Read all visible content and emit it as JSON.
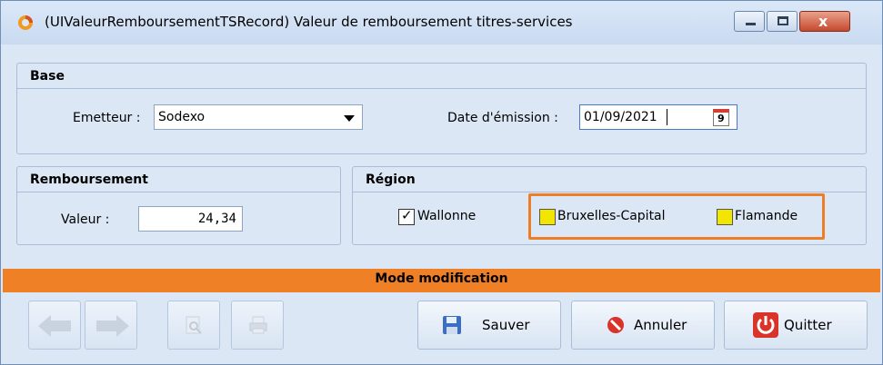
{
  "window": {
    "title": "(UIValeurRemboursementTSRecord) Valeur de remboursement titres-services",
    "close_glyph": "x"
  },
  "base": {
    "heading": "Base",
    "emetteur_label": "Emetteur :",
    "emetteur_value": "Sodexo",
    "date_label": "Date d'émission :",
    "date_value": "01/09/2021",
    "calendar_day": "9"
  },
  "remboursement": {
    "heading": "Remboursement",
    "valeur_label": "Valeur :",
    "valeur_value": "24,34"
  },
  "region": {
    "heading": "Région",
    "options": [
      {
        "label": "Wallonne",
        "checked": true
      },
      {
        "label": "Bruxelles-Capital",
        "checked": false
      },
      {
        "label": "Flamande",
        "checked": false
      }
    ],
    "check_mark": "✓"
  },
  "status": {
    "mode": "Mode modification"
  },
  "toolbar": {
    "save_label": "Sauver",
    "cancel_label": "Annuler",
    "quit_label": "Quitter"
  },
  "colors": {
    "accent_orange": "#ef8026",
    "highlight_border": "#ee7d28",
    "checkbox_yellow": "#f2e600",
    "panel_bg": "#dce7f5"
  }
}
